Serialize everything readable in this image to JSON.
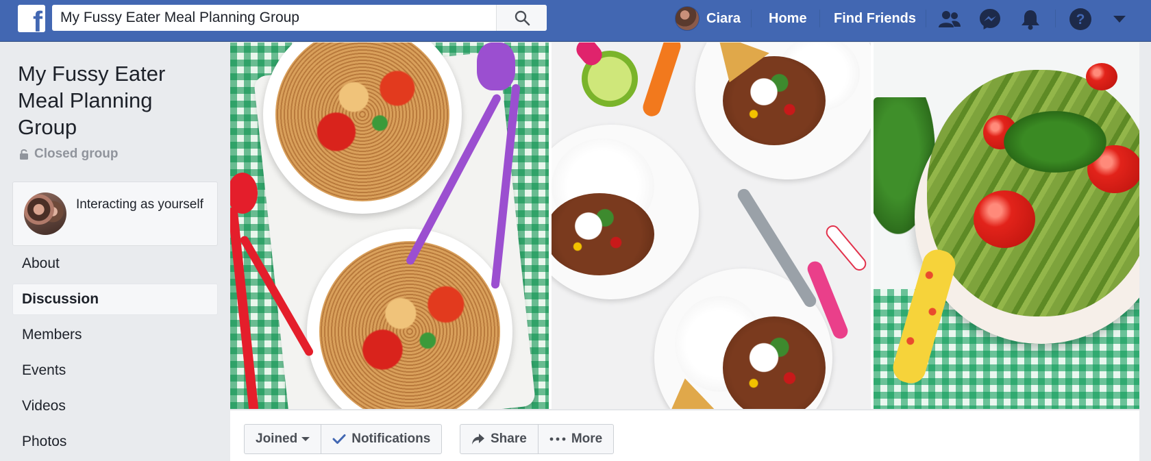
{
  "search": {
    "value": "My Fussy Eater Meal Planning Group"
  },
  "nav": {
    "user_name": "Ciara",
    "home": "Home",
    "find_friends": "Find Friends"
  },
  "group": {
    "title": "My Fussy Eater Meal Planning Group",
    "privacy": "Closed group",
    "interacting_as": "Interacting as yourself"
  },
  "sidebar": {
    "items": [
      {
        "label": "About"
      },
      {
        "label": "Discussion",
        "active": true
      },
      {
        "label": "Members"
      },
      {
        "label": "Events"
      },
      {
        "label": "Videos"
      },
      {
        "label": "Photos"
      }
    ]
  },
  "actions": {
    "joined": "Joined",
    "notifications": "Notifications",
    "share": "Share",
    "more": "More"
  },
  "colors": {
    "brand_blue": "#4267b2",
    "background": "#e9ebee",
    "check_blue": "#4267b2"
  }
}
